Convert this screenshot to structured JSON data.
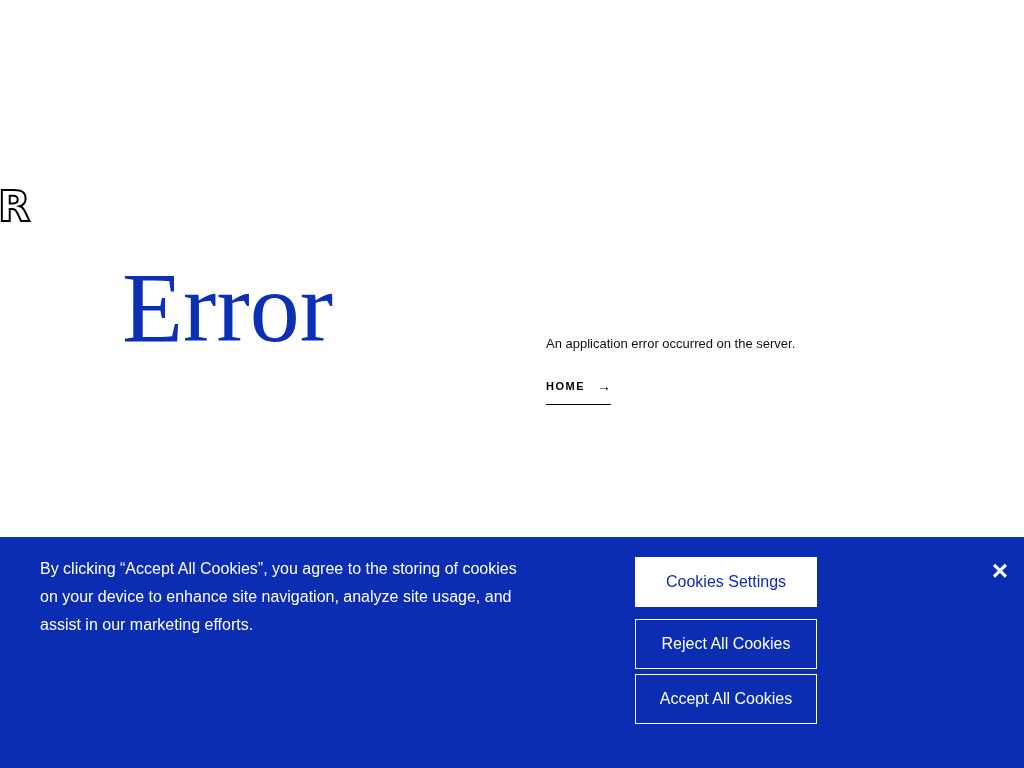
{
  "logo": {
    "text": "R"
  },
  "error": {
    "heading": "Error",
    "message": "An application error occurred on the server.",
    "link": "HOME",
    "link_arrow": "→"
  },
  "cookie_banner": {
    "text": "By clicking “Accept All Cookies”, you agree to the storing of cookies on your device to enhance site navigation, analyze site usage, and assist in our marketing efforts.",
    "buttons": [
      {
        "label": "Cookies Settings",
        "kind": "filled"
      },
      {
        "label": "Reject All Cookies",
        "kind": "outline"
      },
      {
        "label": "Accept All Cookies",
        "kind": "outline"
      }
    ],
    "close": "×"
  }
}
